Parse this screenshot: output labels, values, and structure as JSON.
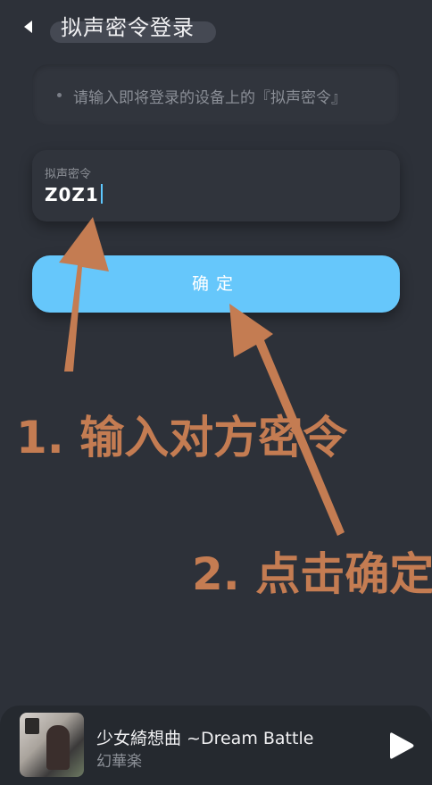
{
  "header": {
    "back_icon": "chevron-left-icon",
    "title": "拟声密令登录"
  },
  "hint": {
    "text": "请输入即将登录的设备上的『拟声密令』"
  },
  "passcode_field": {
    "label": "拟声密令",
    "value": "Z0Z1"
  },
  "confirm_button": {
    "label": "确定"
  },
  "annotations": {
    "step1": "1. 输入对方密令",
    "step2": "2. 点击确定",
    "color": "#c47c52"
  },
  "player": {
    "song_title": "少女綺想曲 ~Dream Battle",
    "artist": "幻華楽",
    "play_icon": "play-icon"
  },
  "colors": {
    "background": "#2d3139",
    "accent": "#66c7fb",
    "caret": "#5ec8ff"
  }
}
